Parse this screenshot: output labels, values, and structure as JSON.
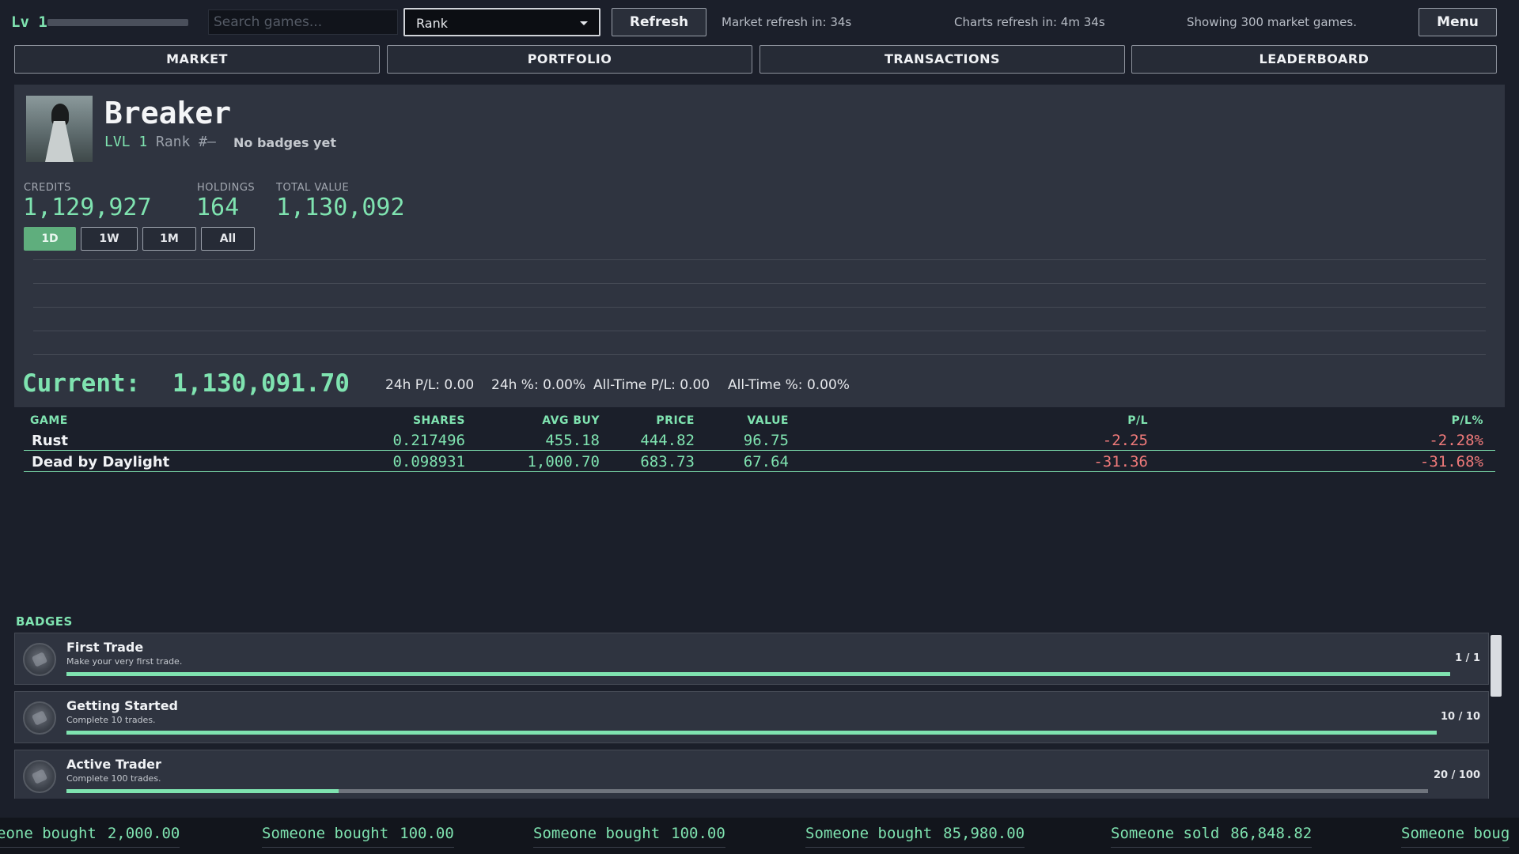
{
  "topbar": {
    "level_label": "Lv 1",
    "xp_progress": 0,
    "search_placeholder": "Search games...",
    "sort_selected": "Rank",
    "refresh_label": "Refresh",
    "market_refresh": "Market refresh in: 34s",
    "charts_refresh": "Charts refresh in: 4m 34s",
    "showing": "Showing 300 market games.",
    "menu_label": "Menu"
  },
  "nav": {
    "tabs": [
      {
        "label": "MARKET"
      },
      {
        "label": "PORTFOLIO"
      },
      {
        "label": "TRANSACTIONS"
      },
      {
        "label": "LEADERBOARD"
      }
    ]
  },
  "profile": {
    "name": "Breaker",
    "level": "LVL 1",
    "rank": "Rank #—",
    "badges_text": "No badges yet",
    "credits_label": "CREDITS",
    "credits": "1,129,927",
    "holdings_label": "HOLDINGS",
    "holdings": "164",
    "total_label": "TOTAL VALUE",
    "total": "1,130,092",
    "ranges": [
      "1D",
      "1W",
      "1M",
      "All"
    ],
    "active_range": "1D",
    "current_label": "Current:",
    "current_value": "1,130,091.70",
    "pl_24h": "24h P/L: 0.00",
    "pct_24h": "24h %: 0.00%",
    "pl_all": "All-Time P/L: 0.00",
    "pct_all": "All-Time %: 0.00%"
  },
  "holdings_table": {
    "headers": [
      "GAME",
      "SHARES",
      "AVG BUY",
      "PRICE",
      "VALUE",
      "P/L",
      "P/L%"
    ],
    "rows": [
      {
        "game": "Rust",
        "shares": "0.217496",
        "avg_buy": "455.18",
        "price": "444.82",
        "value": "96.75",
        "pl": "-2.25",
        "pl_pct": "-2.28%"
      },
      {
        "game": "Dead by Daylight",
        "shares": "0.098931",
        "avg_buy": "1,000.70",
        "price": "683.73",
        "value": "67.64",
        "pl": "-31.36",
        "pl_pct": "-31.68%"
      }
    ]
  },
  "badges": {
    "title": "BADGES",
    "items": [
      {
        "name": "First Trade",
        "desc": "Make your very first trade.",
        "count": "1 / 1",
        "progress": 1.0,
        "icon": "trade-badge-icon"
      },
      {
        "name": "Getting Started",
        "desc": "Complete 10 trades.",
        "count": "10 / 10",
        "progress": 1.0,
        "icon": "rocket-badge-icon"
      },
      {
        "name": "Active Trader",
        "desc": "Complete 100 trades.",
        "count": "20 / 100",
        "progress": 0.2,
        "icon": "trader-badge-icon"
      }
    ]
  },
  "ticker": {
    "items": [
      {
        "text": "eone bought",
        "amount": "2,000.00"
      },
      {
        "text": "Someone bought",
        "amount": "100.00"
      },
      {
        "text": "Someone bought",
        "amount": "100.00"
      },
      {
        "text": "Someone bought",
        "amount": "85,980.00"
      },
      {
        "text": "Someone sold",
        "amount": "86,848.82"
      },
      {
        "text": "Someone boug",
        "amount": ""
      }
    ]
  },
  "colors": {
    "accent": "#7fe3b0",
    "negative": "#f07a7a",
    "panel": "#2f3440",
    "background": "#1b1f2a"
  }
}
